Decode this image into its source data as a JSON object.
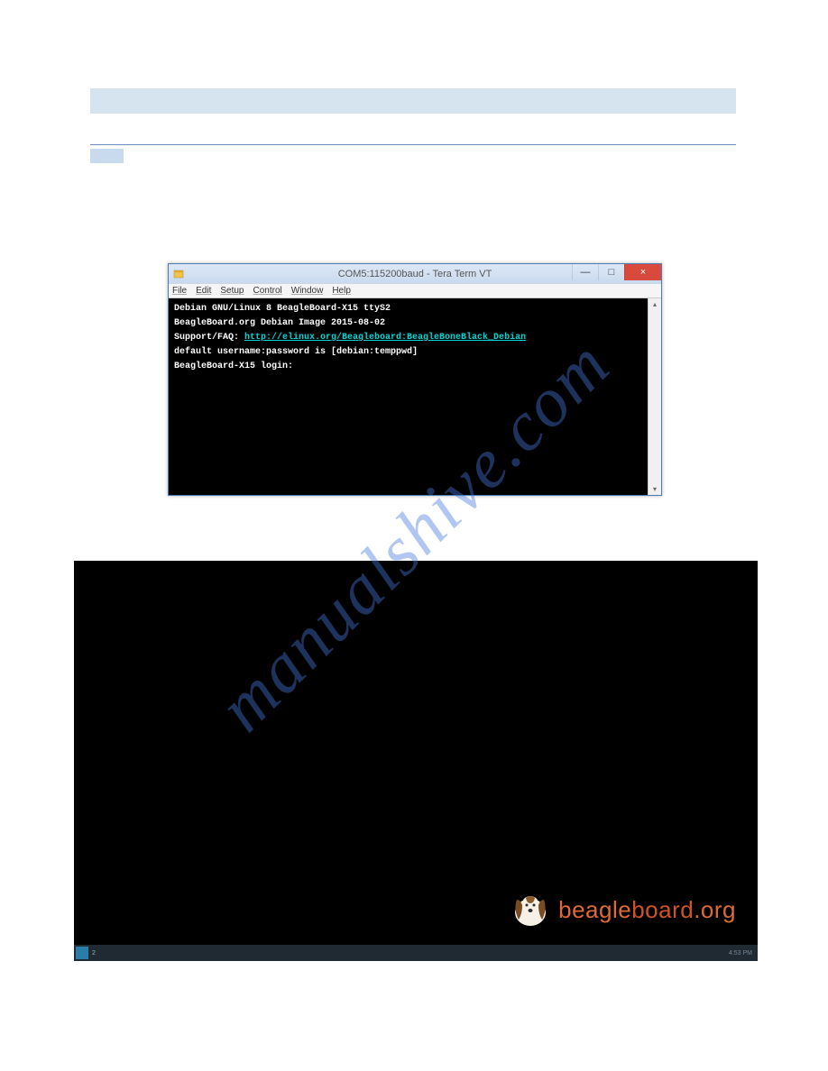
{
  "watermark": "manualshive.com",
  "tera": {
    "title": "COM5:115200baud - Tera Term VT",
    "menus": [
      "File",
      "Edit",
      "Setup",
      "Control",
      "Window",
      "Help"
    ],
    "lines": {
      "l1": "Debian GNU/Linux 8 BeagleBoard-X15 ttyS2",
      "l2": "BeagleBoard.org Debian Image 2015-08-02",
      "l3a": "Support/FAQ: ",
      "l3link": "http://elinux.org/Beagleboard:BeagleBoneBlack_Debian",
      "l4": "default username:password is [debian:temppwd]",
      "l5": "BeagleBoard-X15 login:"
    },
    "buttons": {
      "minimize": "—",
      "maximize": "□",
      "close": "×"
    }
  },
  "desktop": {
    "logo_beagle": "beagle",
    "logo_board": "board",
    "logo_org": ".org",
    "taskbar_items": "2",
    "clock": "4:53 PM"
  }
}
